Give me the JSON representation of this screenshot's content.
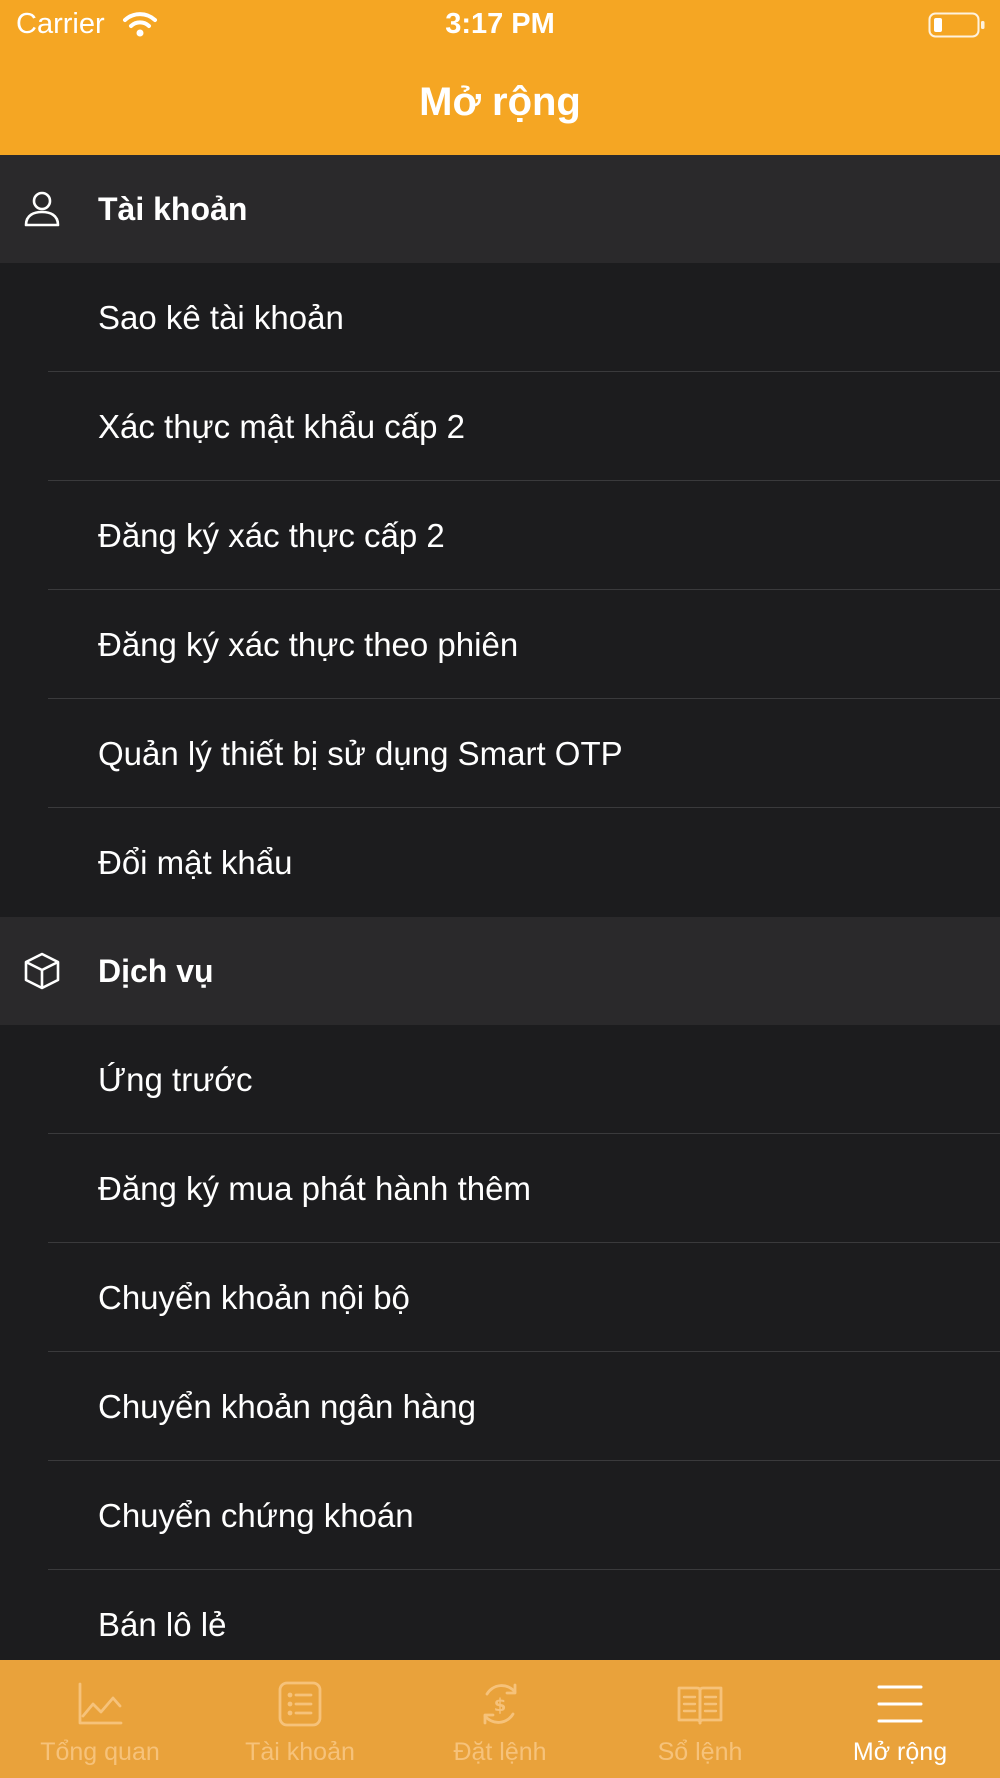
{
  "status_bar": {
    "carrier": "Carrier",
    "time": "3:17 PM"
  },
  "nav": {
    "title": "Mở rộng"
  },
  "sections": [
    {
      "title": "Tài khoản",
      "icon": "person-icon",
      "items": [
        {
          "label": "Sao kê tài khoản"
        },
        {
          "label": "Xác thực mật khẩu cấp 2"
        },
        {
          "label": "Đăng ký xác thực cấp 2"
        },
        {
          "label": "Đăng ký xác thực theo phiên"
        },
        {
          "label": "Quản lý thiết bị sử dụng Smart OTP"
        },
        {
          "label": "Đổi mật khẩu"
        }
      ]
    },
    {
      "title": "Dịch vụ",
      "icon": "box-icon",
      "items": [
        {
          "label": "Ứng trước"
        },
        {
          "label": "Đăng ký mua phát hành thêm"
        },
        {
          "label": "Chuyển khoản nội bộ"
        },
        {
          "label": "Chuyển khoản ngân hàng"
        },
        {
          "label": "Chuyển chứng khoán"
        },
        {
          "label": "Bán lô lẻ"
        }
      ]
    }
  ],
  "tabs": [
    {
      "label": "Tổng quan",
      "icon": "chart-line-icon"
    },
    {
      "label": "Tài khoản",
      "icon": "list-icon"
    },
    {
      "label": "Đặt lệnh",
      "icon": "currency-exchange-icon"
    },
    {
      "label": "Sổ lệnh",
      "icon": "book-icon"
    },
    {
      "label": "Mở rộng",
      "icon": "menu-icon",
      "active": true
    }
  ],
  "colors": {
    "brand": "#f5a623",
    "tab_bar": "#e9a23b",
    "background": "#1c1c1e",
    "section_header": "#2a292b",
    "tab_inactive": "#f6c27a",
    "tab_active": "#ffffff"
  }
}
